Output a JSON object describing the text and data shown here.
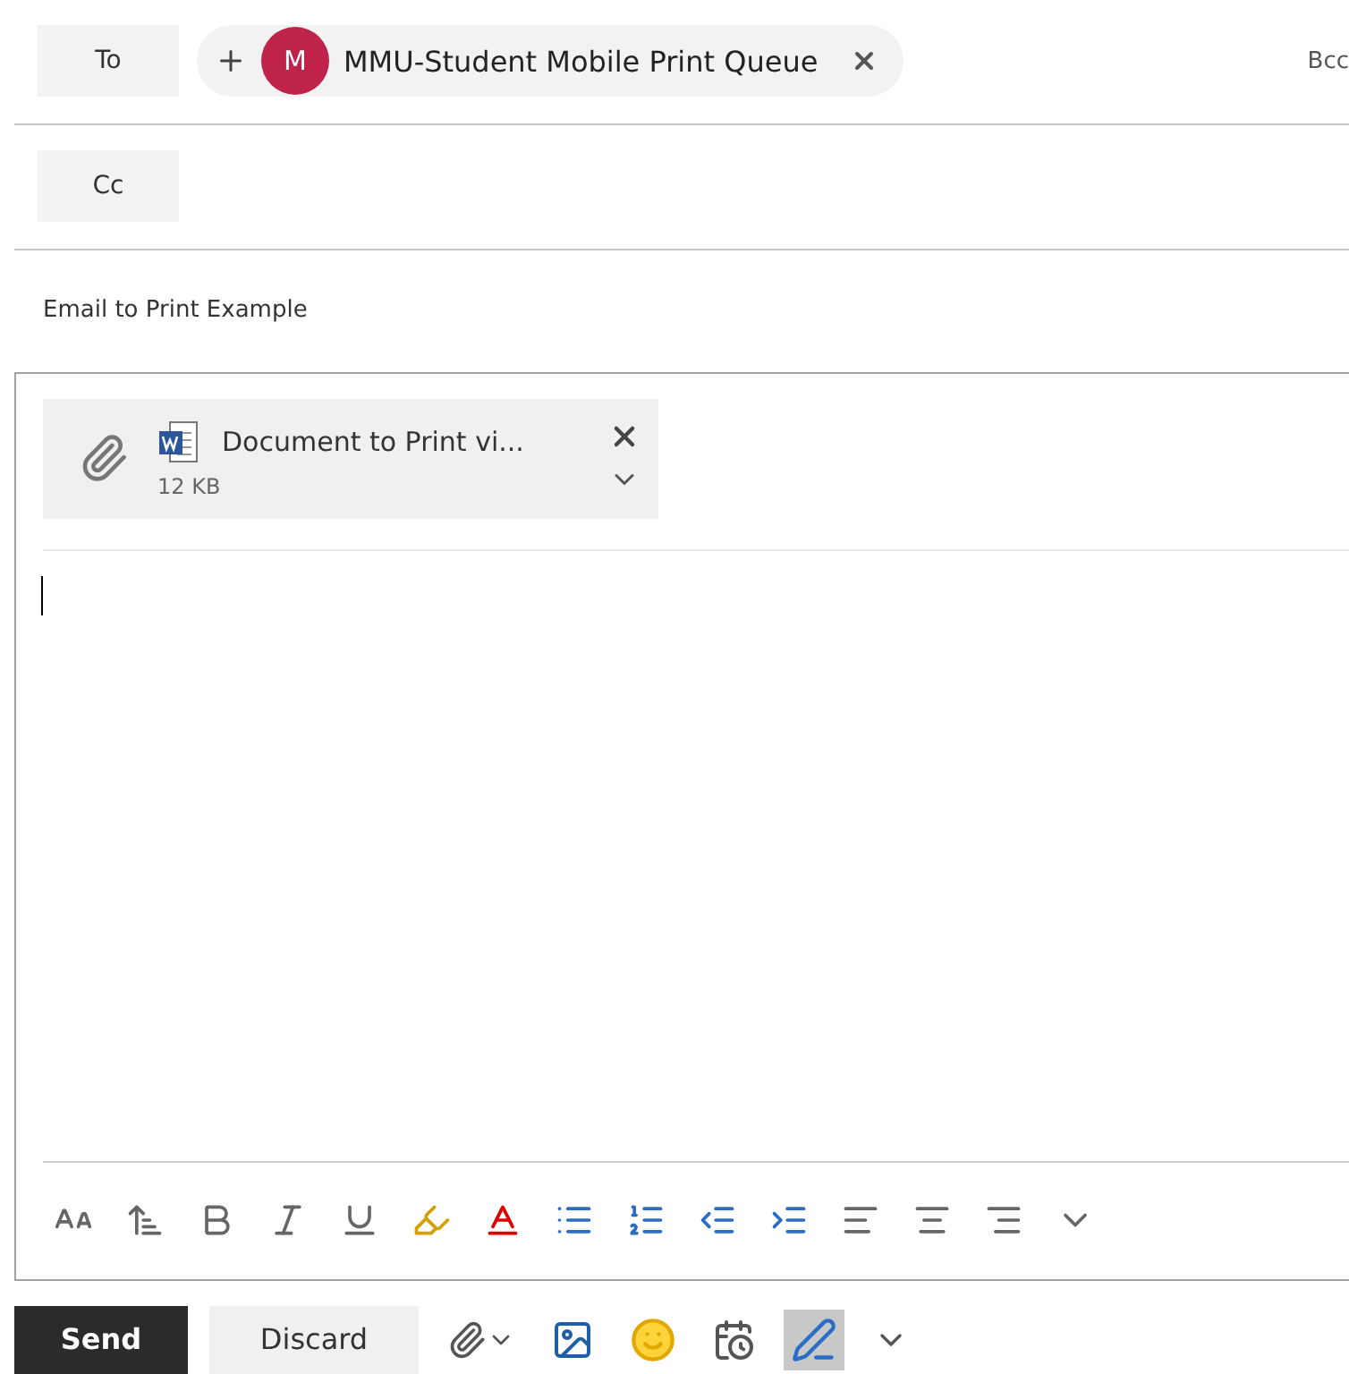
{
  "to": {
    "label": "To",
    "recipients": [
      {
        "initial": "M",
        "name": "MMU-Student Mobile Print Queue",
        "color": "#c0234a"
      }
    ],
    "bcc": "Bcc"
  },
  "cc": {
    "label": "Cc"
  },
  "subject": "Email to Print Example",
  "attachments": [
    {
      "name": "Document to Print vi...",
      "size": "12 KB"
    }
  ],
  "format_tools": [
    {
      "kind": "font-size"
    },
    {
      "kind": "grow-font"
    },
    {
      "kind": "bold"
    },
    {
      "kind": "italic"
    },
    {
      "kind": "underline"
    },
    {
      "kind": "highlight"
    },
    {
      "kind": "font-color"
    },
    {
      "kind": "bullets"
    },
    {
      "kind": "numbering"
    },
    {
      "kind": "outdent"
    },
    {
      "kind": "indent"
    },
    {
      "kind": "align-left"
    },
    {
      "kind": "align-center"
    },
    {
      "kind": "align-right"
    },
    {
      "kind": "more"
    }
  ],
  "actions": [
    {
      "label": "Send",
      "kind": "primary"
    },
    {
      "label": "Discard",
      "kind": "secondary"
    }
  ],
  "insert_tools": [
    {
      "kind": "attach",
      "active": false
    },
    {
      "kind": "picture",
      "active": false
    },
    {
      "kind": "emoji",
      "active": false
    },
    {
      "kind": "schedule",
      "active": false
    },
    {
      "kind": "format",
      "active": true
    },
    {
      "kind": "more",
      "active": false
    }
  ]
}
